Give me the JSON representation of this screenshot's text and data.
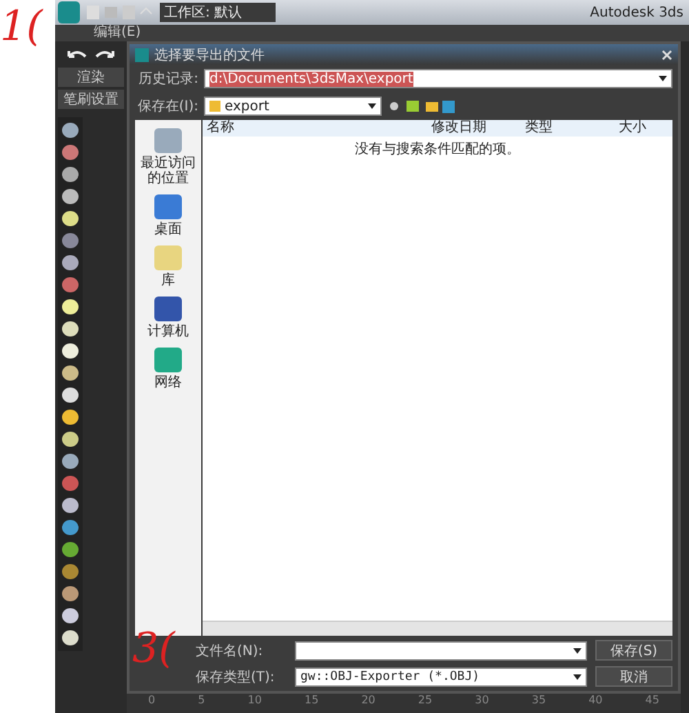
{
  "annotations": {
    "top_mark": "1(",
    "bottom_mark": "3("
  },
  "app": {
    "title": "Autodesk 3ds",
    "workspace": "工作区: 默认",
    "menu": [
      "编辑(E)"
    ],
    "side_buttons": [
      "渲染",
      "笔刷设置"
    ]
  },
  "dialog": {
    "title": "选择要导出的文件",
    "history": {
      "label": "历史记录:",
      "value": "d:\\Documents\\3dsMax\\export"
    },
    "save_in": {
      "label": "保存在(I):",
      "value": "export"
    },
    "places": [
      {
        "label": "最近访问的位置",
        "kind": "recent"
      },
      {
        "label": "桌面",
        "kind": "desktop"
      },
      {
        "label": "库",
        "kind": "library"
      },
      {
        "label": "计算机",
        "kind": "computer"
      },
      {
        "label": "网络",
        "kind": "network"
      }
    ],
    "columns": [
      "名称",
      "修改日期",
      "类型",
      "大小"
    ],
    "empty_message": "没有与搜索条件匹配的项。",
    "filename": {
      "label": "文件名(N):"
    },
    "filetype": {
      "label": "保存类型(T):",
      "value": "gw::OBJ-Exporter (*.OBJ)"
    },
    "buttons": [
      "保存(S)",
      "取消"
    ]
  },
  "timeline": [
    "0",
    "5",
    "10",
    "15",
    "20",
    "25",
    "30",
    "35",
    "40",
    "45"
  ]
}
